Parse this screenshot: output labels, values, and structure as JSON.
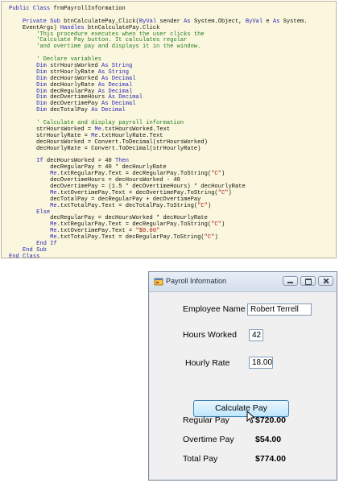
{
  "code": {
    "lines": [
      "Public Class frmPayrollInformation",
      "",
      "    Private Sub btnCalculatePay_Click(ByVal sender As System.Object, ByVal e As System.",
      "    EventArgs) Handles btnCalculatePay.Click",
      "        'This procedure executes when the user clicks the",
      "        'Calculate Pay button. It calculates regular",
      "        'and overtime pay and displays it in the window.",
      "",
      "        ' Declare variables",
      "        Dim strHoursWorked As String",
      "        Dim strHourlyRate As String",
      "        Dim decHoursWorked As Decimal",
      "        Dim decHourlyRate As Decimal",
      "        Dim decRegularPay As Decimal",
      "        Dim decOvertimeHours As Decimal",
      "        Dim decOvertimePay As Decimal",
      "        Dim decTotalPay As Decimal",
      "",
      "        ' Calculate and display payroll information",
      "        strHoursWorked = Me.txtHoursWorked.Text",
      "        strHourlyRate = Me.txtHourlyRate.Text",
      "        decHoursWorked = Convert.ToDecimal(strHoursWorked)",
      "        decHourlyRate = Convert.ToDecimal(strHourlyRate)",
      "",
      "        If decHoursWorked > 40 Then",
      "            decRegularPay = 40 * decHourlyRate",
      "            Me.txtRegularPay.Text = decRegularPay.ToString(\"C\")",
      "            decOvertimeHours = decHoursWorked - 40",
      "            decOvertimePay = (1.5 * decOvertimeHours) * decHourlyRate",
      "            Me.txtOvertimePay.Text = decOvertimePay.ToString(\"C\")",
      "            decTotalPay = decRegularPay + decOvertimePay",
      "            Me.txtTotalPay.Text = decTotalPay.ToString(\"C\")",
      "        Else",
      "            decRegularPay = decHoursWorked * decHourlyRate",
      "            Me.txtRegularPay.Text = decRegularPay.ToString(\"C\")",
      "            Me.txtOvertimePay.Text = \"$0.00\"",
      "            Me.txtTotalPay.Text = decRegularPay.ToString(\"C\")",
      "        End If",
      "    End Sub",
      "End Class"
    ],
    "colors": {
      "keyword": "#2626b8",
      "comment": "#1f7a1f",
      "string": "#a31515",
      "background": "#fbf7de"
    }
  },
  "window": {
    "title": "Payroll Information",
    "icon": "form-icon",
    "controls": {
      "minimize": "minimize-icon",
      "maximize": "maximize-icon",
      "close": "close-icon"
    },
    "fields": {
      "employee_name": {
        "label": "Employee Name",
        "value": "Robert Terrell"
      },
      "hours_worked": {
        "label": "Hours Worked",
        "value": "42"
      },
      "hourly_rate": {
        "label": "Hourly Rate",
        "value": "18.00"
      }
    },
    "calculate_button": "Calculate Pay",
    "results": {
      "regular_pay": {
        "label": "Regular Pay",
        "value": "$720.00"
      },
      "overtime_pay": {
        "label": "Overtime Pay",
        "value": "$54.00"
      },
      "total_pay": {
        "label": "Total Pay",
        "value": "$774.00"
      }
    }
  }
}
